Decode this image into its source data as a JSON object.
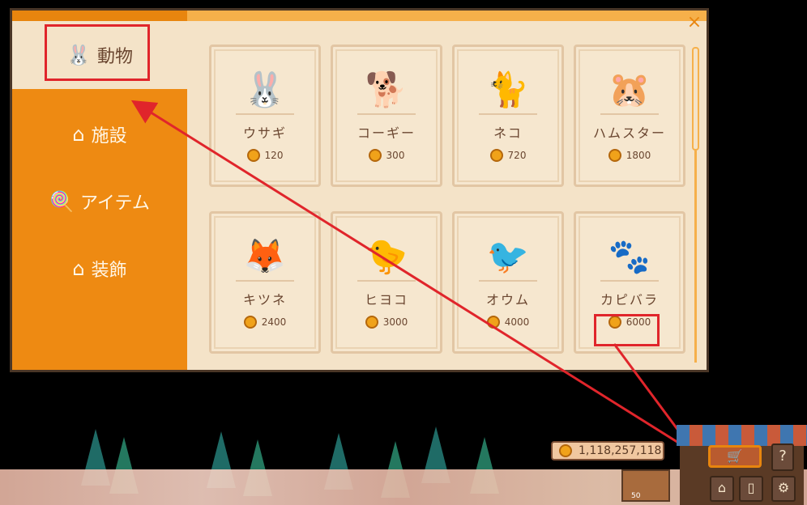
{
  "window": {
    "close_icon": "×"
  },
  "sidebar": {
    "tabs": [
      {
        "label": "動物",
        "icon": "🐰",
        "icon_name": "rabbit-icon"
      },
      {
        "label": "施設",
        "icon": "⌂",
        "icon_name": "house-icon"
      },
      {
        "label": "アイテム",
        "icon": "🍭",
        "icon_name": "lollipop-icon"
      },
      {
        "label": "装飾",
        "icon": "⌂",
        "icon_name": "house-icon"
      }
    ]
  },
  "items": [
    {
      "name": "ウサギ",
      "price": "120",
      "icon": "🐰"
    },
    {
      "name": "コーギー",
      "price": "300",
      "icon": "🐕"
    },
    {
      "name": "ネコ",
      "price": "720",
      "icon": "🐈"
    },
    {
      "name": "ハムスター",
      "price": "1800",
      "icon": "🐹"
    },
    {
      "name": "キツネ",
      "price": "2400",
      "icon": "🦊"
    },
    {
      "name": "ヒヨコ",
      "price": "3000",
      "icon": "🐤"
    },
    {
      "name": "オウム",
      "price": "4000",
      "icon": "🐦"
    },
    {
      "name": "カピバラ",
      "price": "6000",
      "icon": "🐾"
    }
  ],
  "hud": {
    "coins": "1,118,257,118",
    "shop_icon": "🛒",
    "help_label": "?",
    "stall_count": "50",
    "home_icon": "⌂",
    "book_icon": "▯",
    "settings_icon": "⚙"
  },
  "colors": {
    "accent_orange": "#ee8a12",
    "panel_bg": "#f4e3c8",
    "highlight_red": "#e0252b"
  }
}
